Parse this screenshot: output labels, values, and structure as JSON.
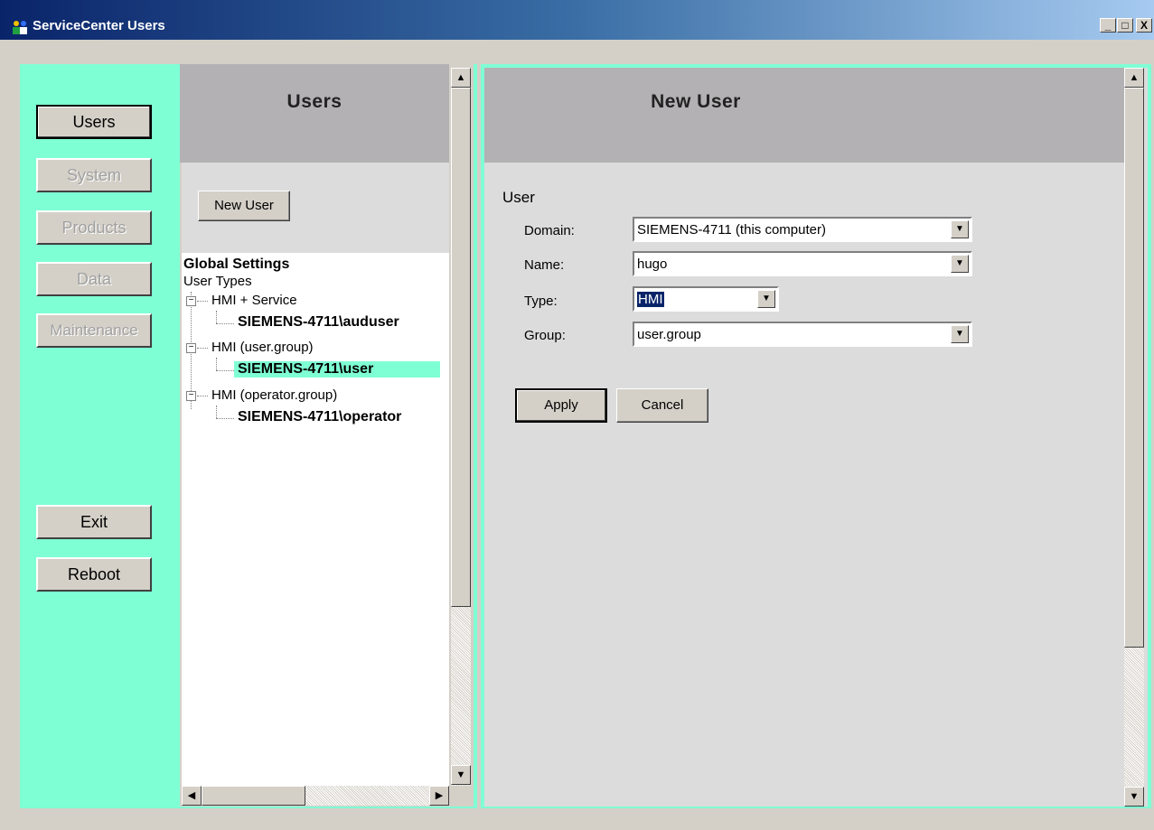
{
  "window": {
    "title": "ServiceCenter Users",
    "minimize": "_",
    "maximize": "□",
    "close": "X"
  },
  "nav": {
    "items": [
      {
        "label": "Users",
        "state": "selected"
      },
      {
        "label": "System",
        "state": "disabled"
      },
      {
        "label": "Products",
        "state": "disabled"
      },
      {
        "label": "Data",
        "state": "disabled"
      },
      {
        "label": "Maintenance",
        "state": "disabled"
      }
    ],
    "exit_label": "Exit",
    "reboot_label": "Reboot"
  },
  "users_panel": {
    "title": "Users",
    "new_user_label": "New User",
    "tree": {
      "global_settings": "Global Settings",
      "user_types": "User Types",
      "groups": [
        {
          "label": "HMI + Service",
          "child": "SIEMENS-4711\\auduser"
        },
        {
          "label": "HMI (user.group)",
          "child": "SIEMENS-4711\\user"
        },
        {
          "label": "HMI (operator.group)",
          "child": "SIEMENS-4711\\operator"
        }
      ],
      "selected_child": "SIEMENS-4711\\user"
    }
  },
  "new_user_panel": {
    "title": "New User",
    "section_label": "User",
    "fields": {
      "domain": {
        "label": "Domain:",
        "value": "SIEMENS-4711 (this computer)"
      },
      "name": {
        "label": "Name:",
        "value": "hugo"
      },
      "type": {
        "label": "Type:",
        "value": "HMI"
      },
      "group": {
        "label": "Group:",
        "value": "user.group"
      }
    },
    "apply_label": "Apply",
    "cancel_label": "Cancel"
  },
  "colors": {
    "accent": "#7fffd4",
    "header_gray": "#b3b1b3",
    "title_gradient_start": "#0a246a"
  }
}
